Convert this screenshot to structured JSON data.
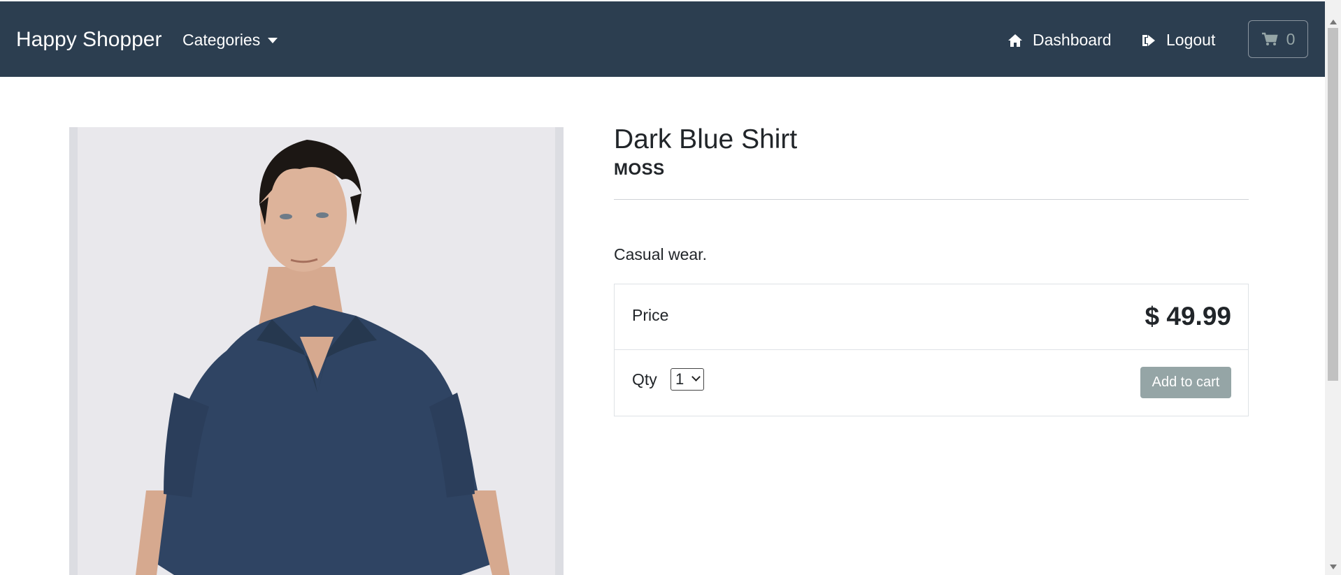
{
  "navbar": {
    "brand": "Happy Shopper",
    "categories_label": "Categories",
    "dashboard_label": "Dashboard",
    "logout_label": "Logout",
    "cart_count": "0"
  },
  "product": {
    "title": "Dark Blue Shirt",
    "brand": "MOSS",
    "description": "Casual wear.",
    "price_label": "Price",
    "price_value": "$ 49.99",
    "qty_label": "Qty",
    "qty_selected": "1",
    "add_to_cart_label": "Add to cart"
  },
  "colors": {
    "navbar_bg": "#2c3e50",
    "button_bg": "#95a5a6",
    "shirt": "#2f4463"
  }
}
